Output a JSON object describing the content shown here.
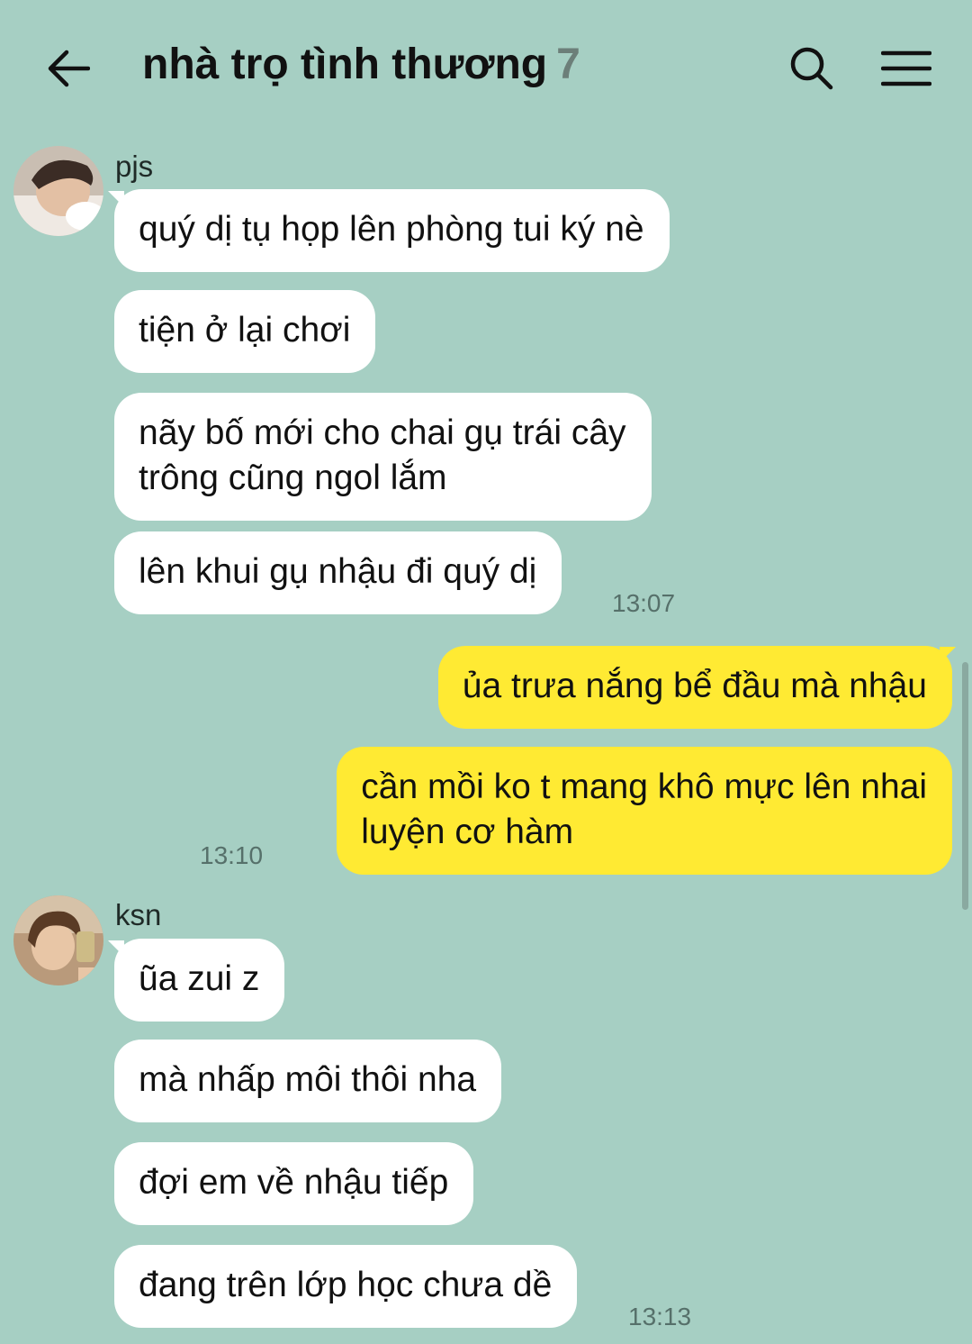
{
  "header": {
    "title": "nhà trọ tình thương",
    "member_count": "7",
    "back_icon": "arrow-left-icon",
    "search_icon": "search-icon",
    "menu_icon": "hamburger-menu-icon"
  },
  "groups": [
    {
      "sender": "pjs",
      "messages": [
        "quý dị tụ họp lên phòng tui ký nè",
        "tiện ở lại chơi",
        "nãy bố mới cho chai gụ trái cây\ntrông cũng ngol lắm",
        "lên khui gụ nhậu đi quý dị"
      ],
      "time": "13:07"
    },
    {
      "sender": "me",
      "messages": [
        "ủa trưa nắng bể đầu mà nhậu",
        "cần mồi ko t mang khô mực lên nhai\nluyện cơ hàm"
      ],
      "time": "13:10"
    },
    {
      "sender": "ksn",
      "messages": [
        "ũa zui z",
        "mà nhấp môi thôi nha",
        "đợi em về nhậu tiếp",
        "đang trên lớp học chưa dề"
      ],
      "time": "13:13"
    }
  ],
  "colors": {
    "background": "#a6cfc3",
    "incoming_bubble": "#ffffff",
    "outgoing_bubble": "#ffea33"
  }
}
